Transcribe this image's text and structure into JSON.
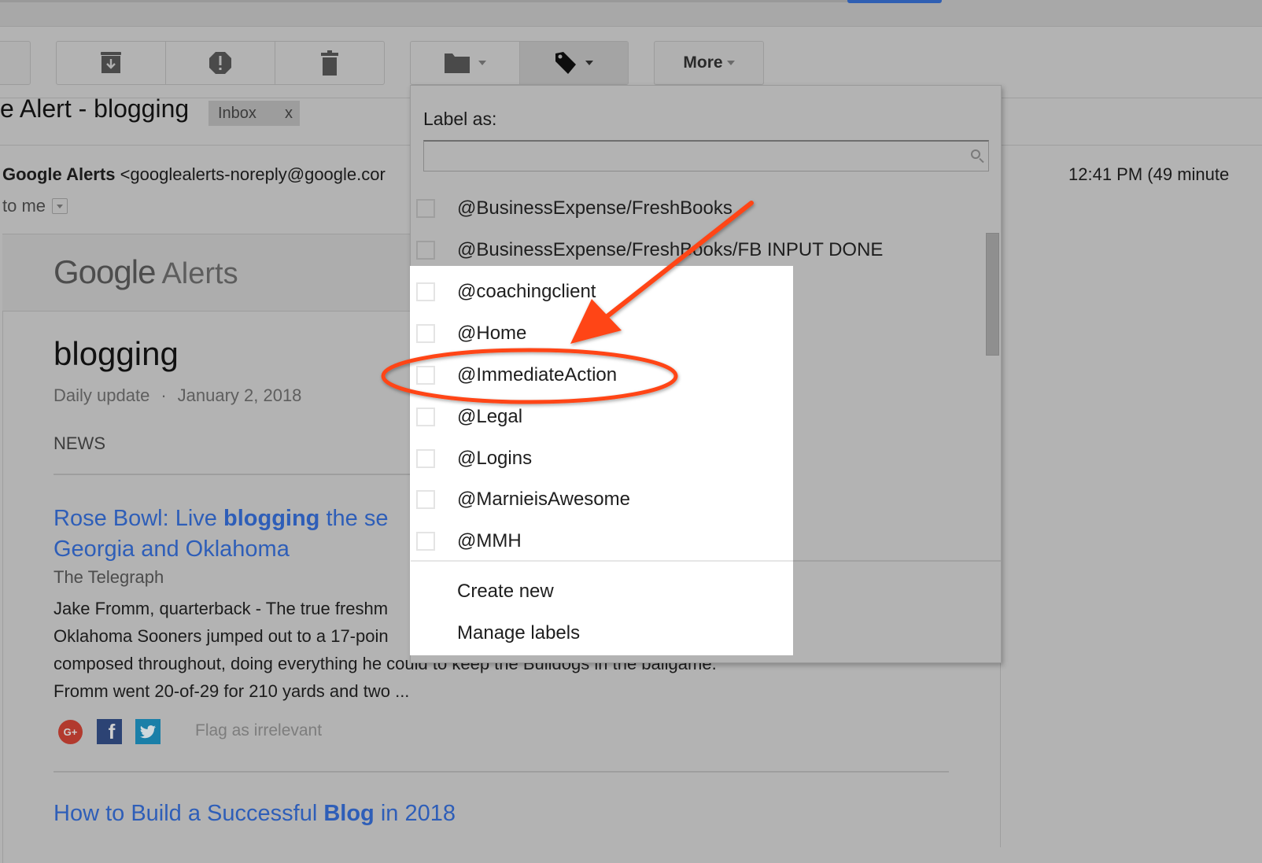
{
  "toolbar": {
    "buttons": [
      {
        "name": "archive",
        "icon": "archive-icon"
      },
      {
        "name": "report-spam",
        "icon": "report-spam-icon"
      },
      {
        "name": "delete",
        "icon": "trash-icon"
      },
      {
        "name": "move-to",
        "icon": "folder-icon"
      },
      {
        "name": "labels",
        "icon": "label-tag-icon",
        "active": true
      }
    ],
    "more_label": "More"
  },
  "email": {
    "subject": "e Alert - blogging",
    "chip_label": "Inbox",
    "chip_close": "x",
    "sender_name": "Google Alerts",
    "sender_email": "<googlealerts-noreply@google.cor",
    "recipient": "to me",
    "timestamp": "12:41 PM (49 minute"
  },
  "alert": {
    "logo_google": "Google",
    "logo_alerts": "Alerts",
    "title": "blogging",
    "frequency": "Daily update",
    "separator": "·",
    "date": "January 2, 2018",
    "section": "NEWS",
    "articles": [
      {
        "title_pre": "Rose Bowl: Live ",
        "title_bold": "blogging",
        "title_post": " the se",
        "title_line2": "Georgia and Oklahoma",
        "source": "The Telegraph",
        "body": [
          "Jake Fromm, quarterback - The true freshm",
          "Oklahoma Sooners jumped out to a 17-poin",
          "composed throughout, doing everything he could to keep the Bulldogs in the ballgame.",
          "Fromm went 20-of-29 for 210 yards and two ..."
        ],
        "flag_label": "Flag as irrelevant"
      },
      {
        "title_pre": "How to Build a Successful ",
        "title_bold": "Blog",
        "title_post": " in 2018"
      }
    ],
    "share_icons": [
      "google-plus-icon",
      "facebook-icon",
      "twitter-icon"
    ],
    "share_glyphs": {
      "gplus": "G+",
      "fb": "f",
      "tw": "🐦"
    }
  },
  "label_menu": {
    "heading": "Label as:",
    "search_value": "",
    "labels": [
      {
        "name": "@BusinessExpense/FreshBooks",
        "checked": false
      },
      {
        "name": "@BusinessExpense/FreshBooks/FB INPUT DONE",
        "checked": false
      },
      {
        "name": "@coachingclient",
        "checked": false
      },
      {
        "name": "@Home",
        "checked": false
      },
      {
        "name": "@ImmediateAction",
        "checked": false,
        "highlighted": true
      },
      {
        "name": "@Legal",
        "checked": false
      },
      {
        "name": "@Logins",
        "checked": false
      },
      {
        "name": "@MarnieisAwesome",
        "checked": false
      },
      {
        "name": "@MMH",
        "checked": false
      }
    ],
    "actions": [
      "Create new",
      "Manage labels"
    ]
  },
  "annotation": {
    "color": "#ff4516",
    "target_label": "@ImmediateAction"
  }
}
